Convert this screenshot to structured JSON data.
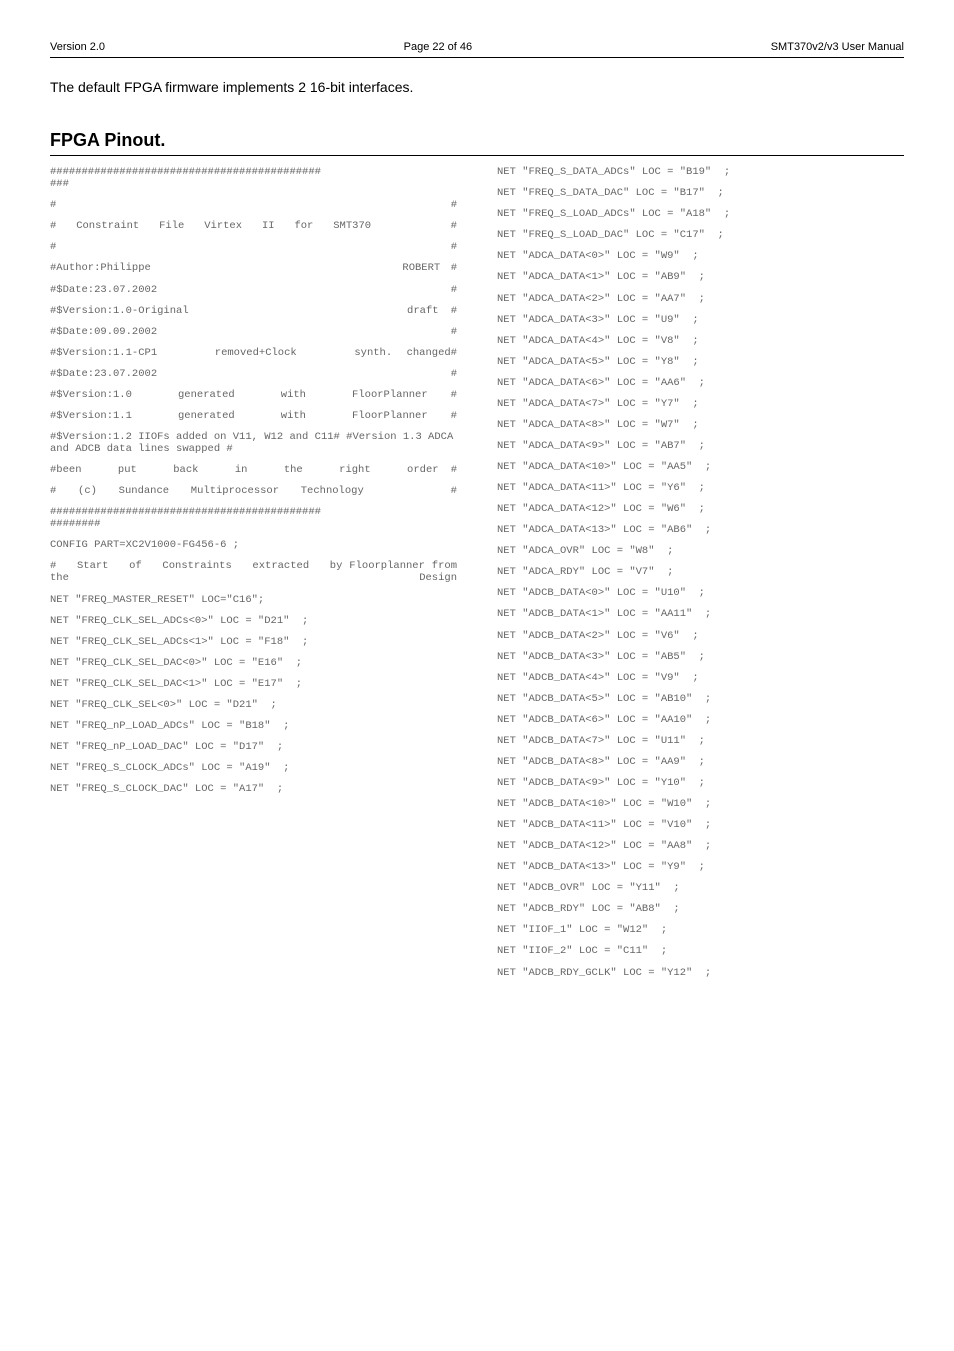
{
  "header": {
    "left": "Version 2.0",
    "center": "Page 22 of 46",
    "right": "SMT370v2/v3 User Manual"
  },
  "intro": "The default FPGA firmware implements 2 16-bit interfaces.",
  "heading": "FPGA Pinout.",
  "left_col": {
    "l1": "###########################################\n###",
    "l2": "#                                  #",
    "l3": "#  Constraint  File  Virtex  II  for  SMT370        #",
    "l4": "#                                  #",
    "l5": "#Author:Philippe                        ROBERT #",
    "l6": "#$Date:23.07.2002                          #",
    "l7": "#$Version:1.0-Original                  draft #",
    "l8": "#$Date:09.09.2002                          #",
    "l9": "#$Version:1.1-CP1    removed+Clock    synth. changed#",
    "l10": "#$Date:23.07.2002                          #",
    "l11": "#$Version:1.0  generated  with  FloorPlanner #",
    "l12": "#$Version:1.1  generated  with  FloorPlanner #",
    "l13": "#$Version:1.2 IIOFs added on V11, W12 and C11# #Version 1.3 ADCA and ADCB data lines swapped #",
    "l14": "#been   put   back   in   the   right   order #",
    "l15": "#  (c)  Sundance  Multiprocessor  Technology        #",
    "l16": "###########################################\n########",
    "l17": "CONFIG PART=XC2V1000-FG456-6 ;",
    "l18": "",
    "l19": "#   Start   of   Constraints   extracted   by Floorplanner from the Design",
    "l20": "NET \"FREQ_MASTER_RESET\" LOC=\"C16\";",
    "l21": "NET \"FREQ_CLK_SEL_ADCs<0>\" LOC = \"D21\"  ;",
    "l22": "NET \"FREQ_CLK_SEL_ADCs<1>\" LOC = \"F18\"  ;",
    "l23": "NET \"FREQ_CLK_SEL_DAC<0>\" LOC = \"E16\"  ;",
    "l24": "NET \"FREQ_CLK_SEL_DAC<1>\" LOC = \"E17\"  ;",
    "l25": "NET \"FREQ_CLK_SEL<0>\" LOC = \"D21\"  ;",
    "l26": "NET \"FREQ_nP_LOAD_ADCs\" LOC = \"B18\"  ;",
    "l27": "NET \"FREQ_nP_LOAD_DAC\" LOC = \"D17\"  ;",
    "l28": "NET \"FREQ_S_CLOCK_ADCs\" LOC = \"A19\"  ;",
    "l29": "NET \"FREQ_S_CLOCK_DAC\" LOC = \"A17\"  ;"
  },
  "right_col": {
    "r1": "NET \"FREQ_S_DATA_ADCs\" LOC = \"B19\"  ;",
    "r2": "NET \"FREQ_S_DATA_DAC\" LOC = \"B17\"  ;",
    "r3": "NET \"FREQ_S_LOAD_ADCs\" LOC = \"A18\"  ;",
    "r4": "NET \"FREQ_S_LOAD_DAC\" LOC = \"C17\"  ;",
    "r5": "NET \"ADCA_DATA<0>\" LOC = \"W9\"  ;",
    "r6": "NET \"ADCA_DATA<1>\" LOC = \"AB9\"  ;",
    "r7": "NET \"ADCA_DATA<2>\" LOC = \"AA7\"  ;",
    "r8": "NET \"ADCA_DATA<3>\" LOC = \"U9\"  ;",
    "r9": "NET \"ADCA_DATA<4>\" LOC = \"V8\"  ;",
    "r10": "NET \"ADCA_DATA<5>\" LOC = \"Y8\"  ;",
    "r11": "NET \"ADCA_DATA<6>\" LOC = \"AA6\"  ;",
    "r12": "NET \"ADCA_DATA<7>\" LOC = \"Y7\"  ;",
    "r13": "NET \"ADCA_DATA<8>\" LOC = \"W7\"  ;",
    "r14": "NET \"ADCA_DATA<9>\" LOC = \"AB7\"  ;",
    "r15": "NET \"ADCA_DATA<10>\" LOC = \"AA5\"  ;",
    "r16": "NET \"ADCA_DATA<11>\" LOC = \"Y6\"  ;",
    "r17": "NET \"ADCA_DATA<12>\" LOC = \"W6\"  ;",
    "r18": "NET \"ADCA_DATA<13>\" LOC = \"AB6\"  ;",
    "r19": "NET \"ADCA_OVR\" LOC = \"W8\"  ;",
    "r20": "NET \"ADCA_RDY\" LOC = \"V7\"  ;",
    "r21": "NET \"ADCB_DATA<0>\" LOC = \"U10\"  ;",
    "r22": "NET \"ADCB_DATA<1>\" LOC = \"AA11\"  ;",
    "r23": "NET \"ADCB_DATA<2>\" LOC = \"V6\"  ;",
    "r24": "NET \"ADCB_DATA<3>\" LOC = \"AB5\"  ;",
    "r25": "NET \"ADCB_DATA<4>\" LOC = \"V9\"  ;",
    "r26": "NET \"ADCB_DATA<5>\" LOC = \"AB10\"  ;",
    "r27": "NET \"ADCB_DATA<6>\" LOC = \"AA10\"  ;",
    "r28": "NET \"ADCB_DATA<7>\" LOC = \"U11\"  ;",
    "r29": "NET \"ADCB_DATA<8>\" LOC = \"AA9\"  ;",
    "r30": "NET \"ADCB_DATA<9>\" LOC = \"Y10\"  ;",
    "r31": "NET \"ADCB_DATA<10>\" LOC = \"W10\"  ;",
    "r32": "NET \"ADCB_DATA<11>\" LOC = \"V10\"  ;",
    "r33": "NET \"ADCB_DATA<12>\" LOC = \"AA8\"  ;",
    "r34": "NET \"ADCB_DATA<13>\" LOC = \"Y9\"  ;",
    "r35": "NET \"ADCB_OVR\" LOC = \"Y11\"  ;",
    "r36": "NET \"ADCB_RDY\" LOC = \"AB8\"  ;",
    "r37": "NET \"IIOF_1\" LOC = \"W12\"  ;",
    "r38": "NET \"IIOF_2\" LOC = \"C11\"  ;",
    "r39": "NET \"ADCB_RDY_GCLK\" LOC = \"Y12\"  ;"
  }
}
